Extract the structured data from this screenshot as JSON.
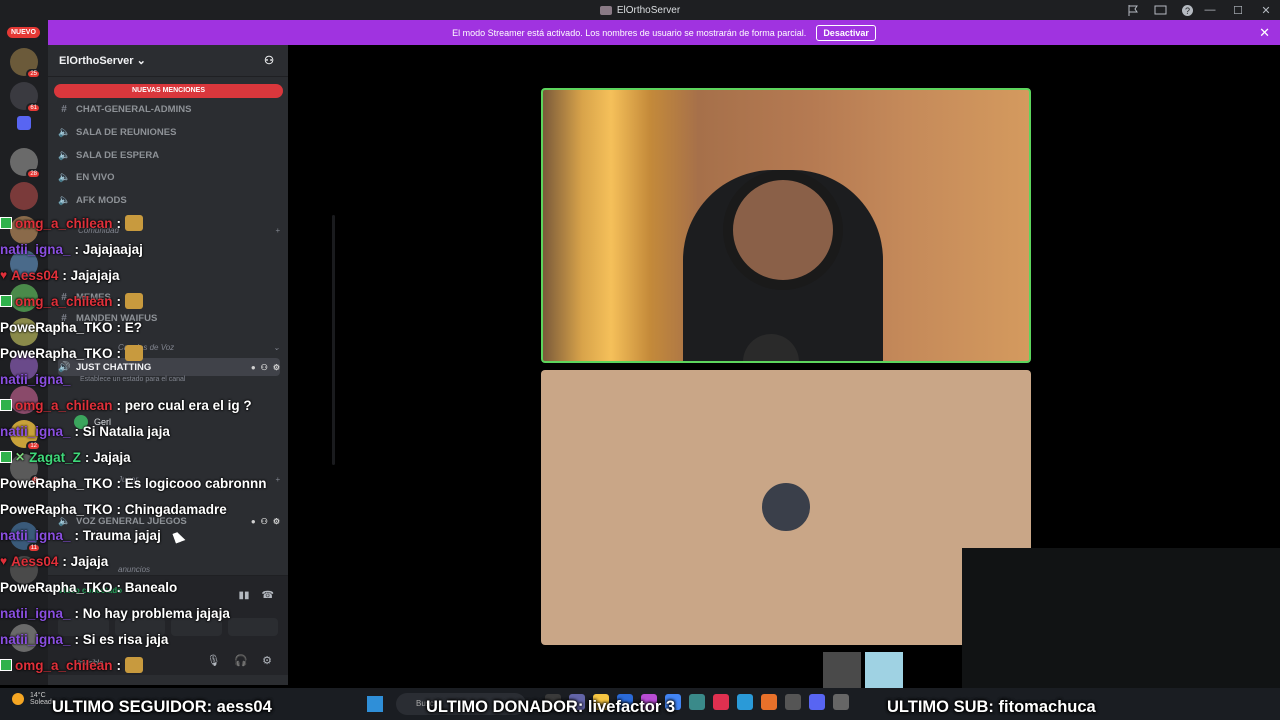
{
  "window": {
    "title": "ElOrthoServer"
  },
  "banner": {
    "text": "El modo Streamer está activado. Los nombres de usuario se mostrarán de forma parcial.",
    "button": "Desactivar"
  },
  "rail": {
    "nuevo": "NUEVO",
    "badges": [
      "25",
      "61",
      "28",
      "8",
      "12",
      "11"
    ]
  },
  "server": {
    "name": "ElOrthoServer"
  },
  "sidebar": {
    "mentions": "NUEVAS MENCIONES",
    "channels": [
      {
        "label": "CHAT-GENERAL-ADMINS",
        "icon": "hash-icon"
      },
      {
        "label": "SALA DE REUNIONES",
        "icon": "speaker-icon"
      },
      {
        "label": "SALA DE ESPERA",
        "icon": "speaker-icon"
      },
      {
        "label": "EN VIVO",
        "icon": "speaker-icon"
      },
      {
        "label": "AFK MODS",
        "icon": "speaker-icon"
      }
    ],
    "categories": [
      "Comunidad",
      "Canales de Voz"
    ],
    "memes": "MEMES",
    "waifus": "MANDEN WAIFUS",
    "just_chatting": "JUST CHATTING",
    "set_status": "Establece un estado para el canal",
    "user_in_channel": "Gerl",
    "jugar": "Jugar",
    "voz_general": "VOZ GENERAL JUEGOS",
    "anuncios": "anuncios"
  },
  "voice": {
    "connected": "Vídeo conectado",
    "status": "Invisible"
  },
  "chat": [
    {
      "user": "omg_a_chilean",
      "text": ":",
      "color": "#e0303a",
      "prefix": "check",
      "emote": true
    },
    {
      "user": "natii_igna_",
      "text": ": Jajajaajaj",
      "color": "#8a4fe0",
      "prefix": ""
    },
    {
      "user": "Aess04",
      "text": ": Jajajaja",
      "color": "#e0303a",
      "prefix": "heart"
    },
    {
      "user": "omg_a_chilean",
      "text": ":",
      "color": "#e0303a",
      "prefix": "check",
      "emote": true
    },
    {
      "user": "PoweRapha_TKO",
      "text": ": E?",
      "color": "#ffffff",
      "prefix": ""
    },
    {
      "user": "PoweRapha_TKO",
      "text": ":",
      "color": "#ffffff",
      "prefix": "",
      "emote": true
    },
    {
      "user": "natii_igna_",
      "text": "",
      "color": "#8a4fe0",
      "prefix": ""
    },
    {
      "user": "omg_a_chilean",
      "text": ": pero cual era el ig ?",
      "color": "#e0303a",
      "prefix": "check"
    },
    {
      "user": "natii_igna_",
      "text": ": Si Natalia jaja",
      "color": "#8a4fe0",
      "prefix": ""
    },
    {
      "user": "Zagat_Z",
      "text": ": Jajaja",
      "color": "#3fd97a",
      "prefix": "check-sword"
    },
    {
      "user": "PoweRapha_TKO",
      "text": ": Es logicooo cabronnn",
      "color": "#ffffff",
      "prefix": ""
    },
    {
      "user": "PoweRapha_TKO",
      "text": ": Chingadamadre",
      "color": "#ffffff",
      "prefix": ""
    },
    {
      "user": "natii_igna_",
      "text": ": Trauma jajaj",
      "color": "#8a4fe0",
      "prefix": ""
    },
    {
      "user": "Aess04",
      "text": ": Jajaja",
      "color": "#e0303a",
      "prefix": "heart"
    },
    {
      "user": "PoweRapha_TKO",
      "text": ": Banealo",
      "color": "#ffffff",
      "prefix": ""
    },
    {
      "user": "natii_igna_",
      "text": ": No hay problema jajaja",
      "color": "#8a4fe0",
      "prefix": ""
    },
    {
      "user": "natii_igna_",
      "text": ": Si es risa jaja",
      "color": "#8a4fe0",
      "prefix": ""
    },
    {
      "user": "omg_a_chilean",
      "text": ":",
      "color": "#e0303a",
      "prefix": "check",
      "emote": true
    }
  ],
  "weather": {
    "temp": "14°C",
    "desc": "Soleado"
  },
  "taskbar": {
    "search": "Buscar"
  },
  "overlay": {
    "seguidor": "ULTIMO SEGUIDOR: aess04",
    "donador": "ULTIMO DONADOR: livefactor 3",
    "sub": "ULTIMO SUB: fitomachuca"
  },
  "colors": {
    "banner": "#a033e0",
    "mention": "#da373c",
    "cam_border": "#5dd55d"
  }
}
